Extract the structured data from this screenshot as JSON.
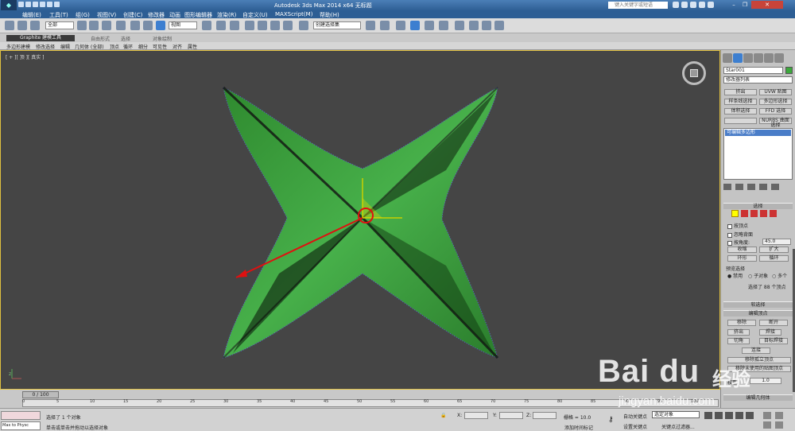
{
  "titlebar": {
    "title": "Autodesk 3ds Max  2014 x64      无标题",
    "search_placeholder": "键入关键字或短语"
  },
  "menu": [
    "编辑(E)",
    "工具(T)",
    "组(G)",
    "视图(V)",
    "创建(C)",
    "修改器",
    "动画",
    "图形编辑器",
    "渲染(R)",
    "自定义(U)",
    "MAXScript(M)",
    "帮助(H)"
  ],
  "toolbar": {
    "filter": "全部",
    "view": "视图",
    "selection_set": "创建选择集"
  },
  "ribbon": {
    "active_tab": "Graphite 建模工具",
    "tabs": [
      "自由形式",
      "选择",
      "对象绘制"
    ],
    "subtabs": [
      "多边形建模",
      "修改选择",
      "编辑",
      "几何体 (全部)",
      "顶点",
      "循环",
      "细分",
      "可见性",
      "对齐",
      "属性"
    ]
  },
  "viewport": {
    "label": "[ + ][ 顶 ][ 真实 ]"
  },
  "command_panel": {
    "object_name": "Star001",
    "modifier_list": "修改器列表",
    "buttons": [
      "挤出",
      "UVW 贴图",
      "样条线选择",
      "多边形选择",
      "体积选择",
      "FFD 选择",
      "",
      "NURBS 曲面选择"
    ],
    "stack_item": "可编辑多边形",
    "selection_rollout": "选择",
    "by_vertex": "按顶点",
    "ignore_backfacing": "忽略背面",
    "by_angle": "按角度:",
    "angle_value": "45.0",
    "shrink": "收缩",
    "grow": "扩大",
    "ring": "环形",
    "loop": "循环",
    "preview_selection": "预览选择",
    "disabled": "禁用",
    "sub_object": "子对象",
    "multi": "多个",
    "selected_status": "选择了 88 个顶点",
    "soft_selection": "软选择",
    "edit_vertices": "编辑顶点",
    "remove": "移除",
    "break": "断开",
    "extrude": "挤出",
    "weld": "焊接",
    "chamfer": "切角",
    "target_weld": "目标焊接",
    "connect": "连接",
    "remove_isolated": "移除孤立顶点",
    "remove_unused_map": "移除未使用的贴图顶点",
    "weight_label": "权重:",
    "weight_value": "1.0",
    "edit_geometry": "编辑几何体"
  },
  "timeline": {
    "frame": "0 / 100",
    "ticks": [
      "0",
      "5",
      "10",
      "15",
      "20",
      "25",
      "30",
      "35",
      "40",
      "45",
      "50",
      "55",
      "60",
      "65",
      "70",
      "75",
      "80",
      "85",
      "90",
      "95",
      "100"
    ]
  },
  "status": {
    "script": "Max to Physc",
    "selected": "选择了 1 个对象",
    "prompt": "单击或单击并拖动以选择对象",
    "x_label": "X:",
    "y_label": "Y:",
    "z_label": "Z:",
    "grid": "栅格 = 10.0",
    "add_time_tag": "添加时间标记",
    "auto_key": "自动关键点",
    "selected_object": "选定对象",
    "set_key": "设置关键点",
    "key_filters": "关键点过滤器..."
  },
  "watermark": {
    "brand": "Bai  du",
    "cn": "经验",
    "url": "jingyan.baidu.com"
  }
}
